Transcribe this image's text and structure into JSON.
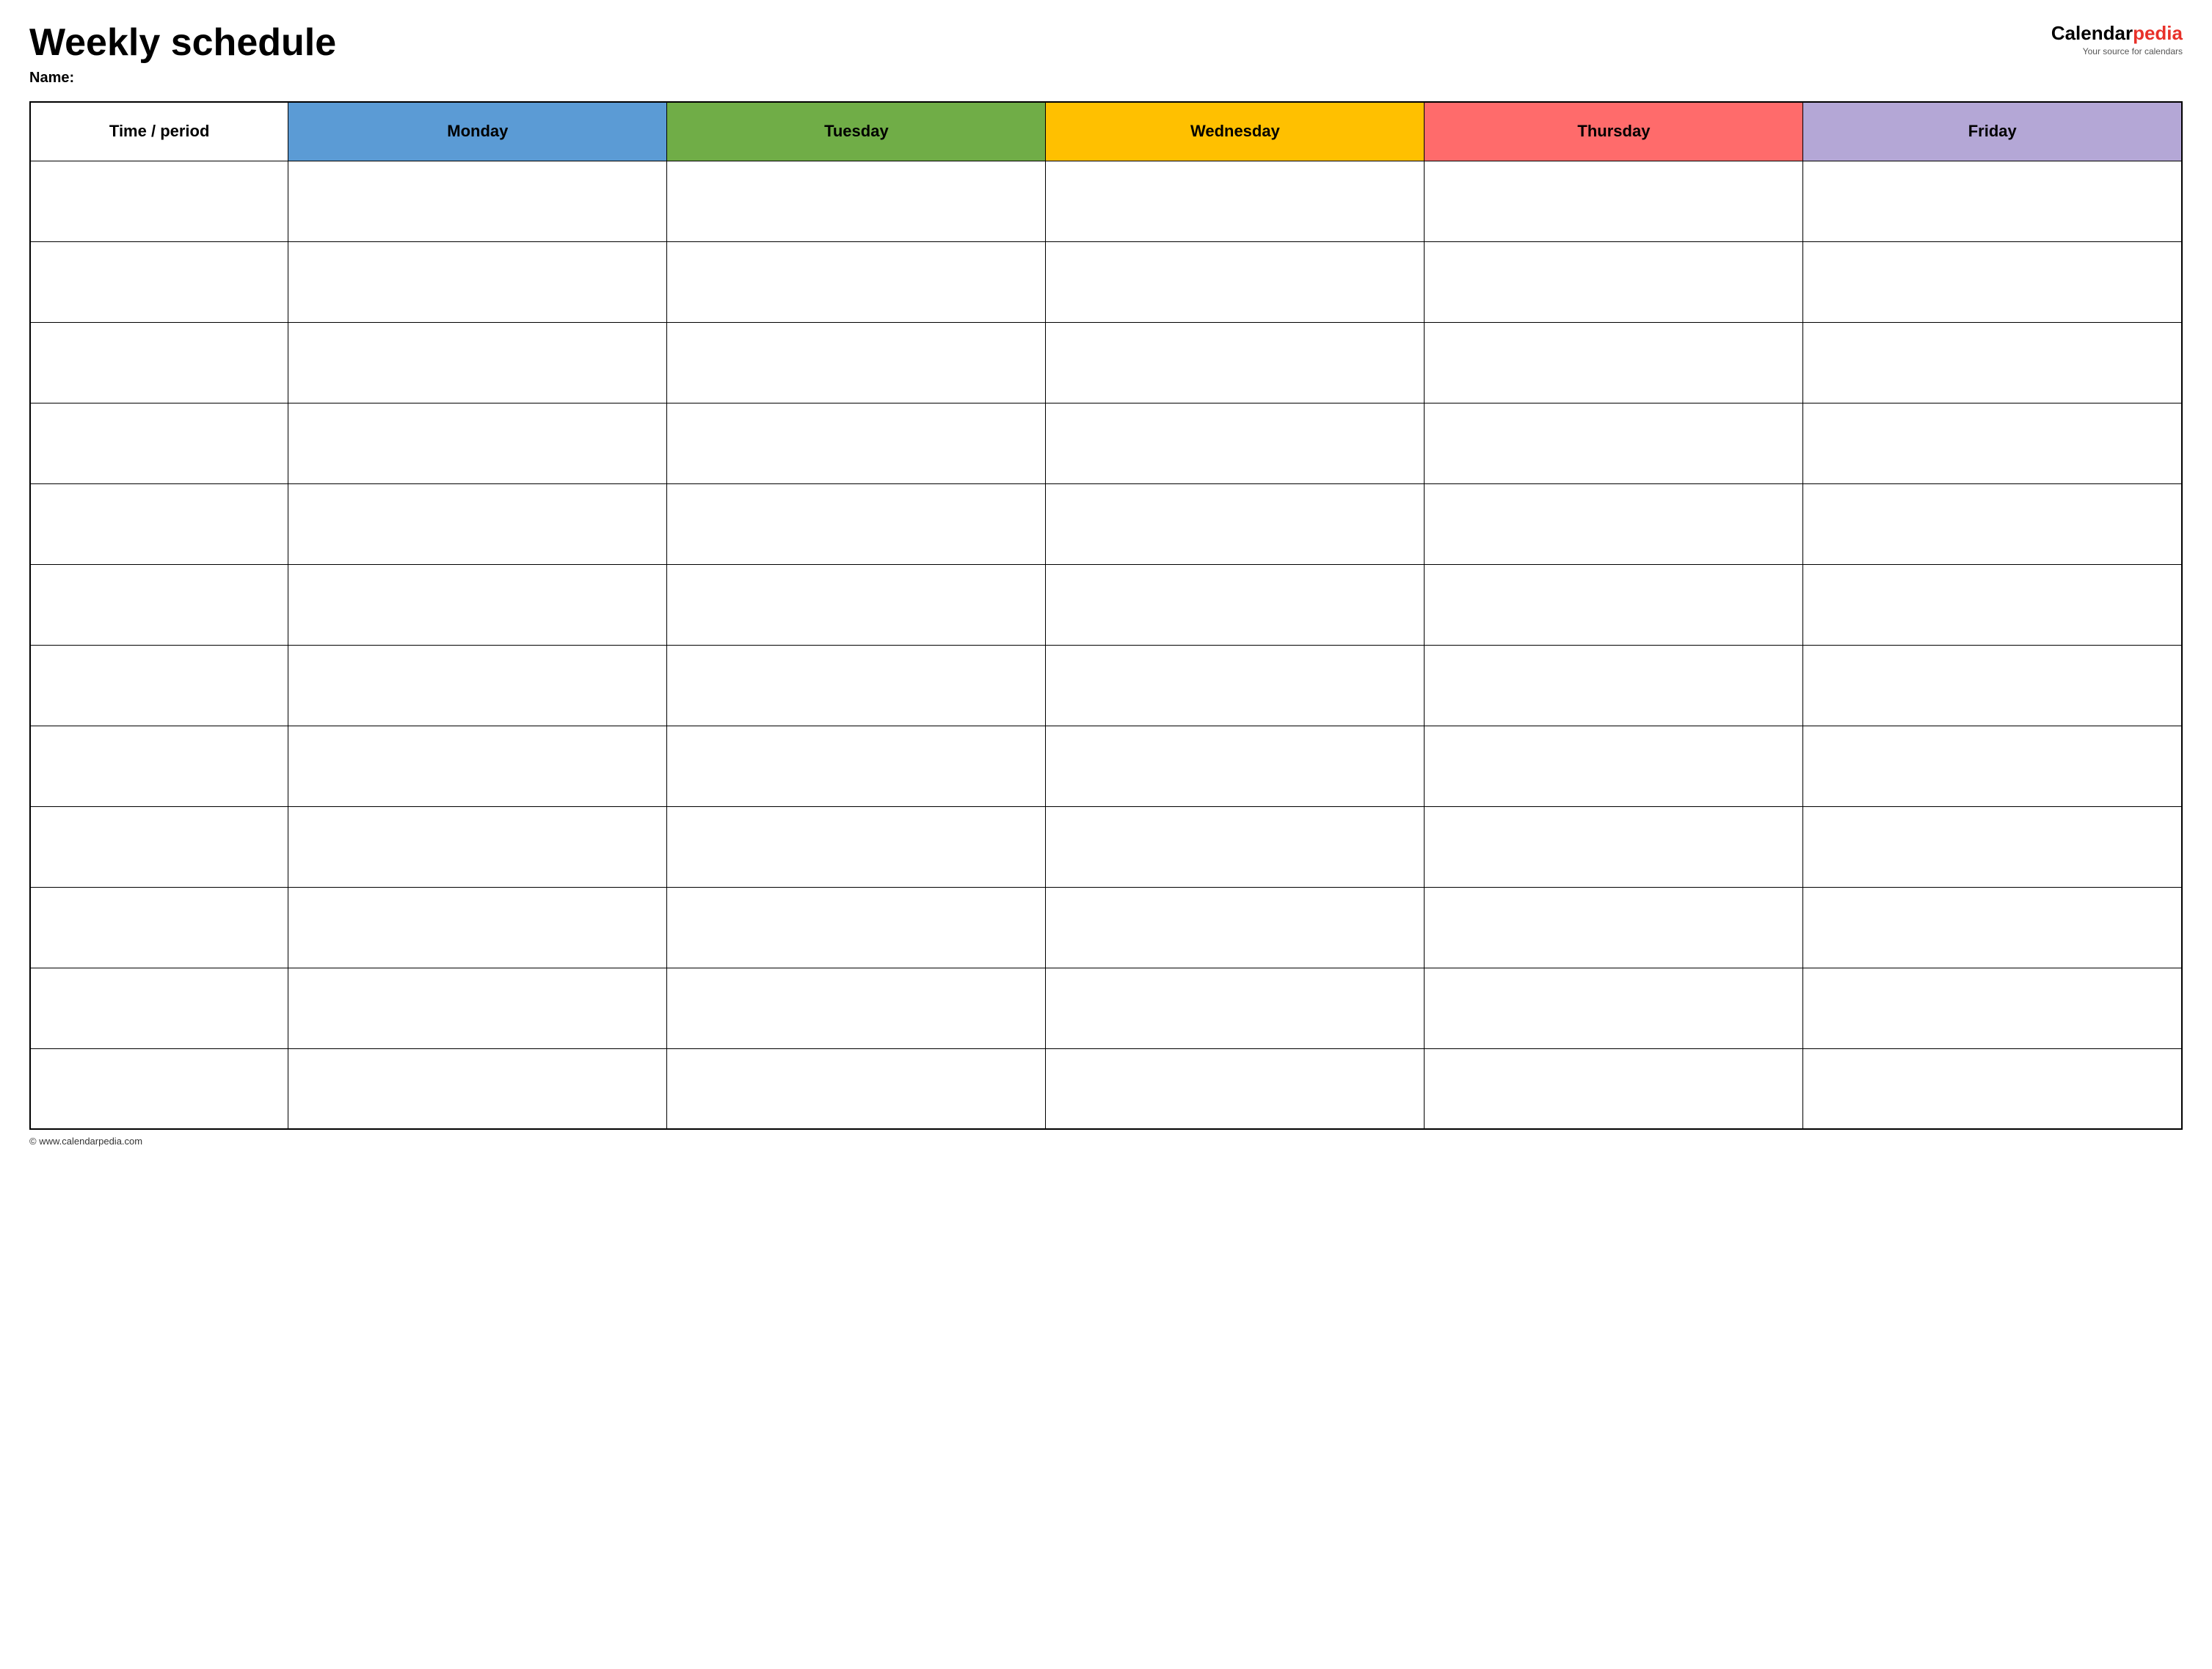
{
  "header": {
    "title": "Weekly schedule",
    "name_label": "Name:",
    "logo": {
      "calendar_text": "Calendar",
      "pedia_text": "pedia",
      "tagline": "Your source for calendars"
    }
  },
  "table": {
    "columns": [
      {
        "id": "time",
        "label": "Time / period",
        "color": "#ffffff"
      },
      {
        "id": "monday",
        "label": "Monday",
        "color": "#5b9bd5"
      },
      {
        "id": "tuesday",
        "label": "Tuesday",
        "color": "#70ad47"
      },
      {
        "id": "wednesday",
        "label": "Wednesday",
        "color": "#ffc000"
      },
      {
        "id": "thursday",
        "label": "Thursday",
        "color": "#ff6b6b"
      },
      {
        "id": "friday",
        "label": "Friday",
        "color": "#b4a7d6"
      }
    ],
    "rows": 12
  },
  "footer": {
    "text": "© www.calendarpedia.com"
  }
}
